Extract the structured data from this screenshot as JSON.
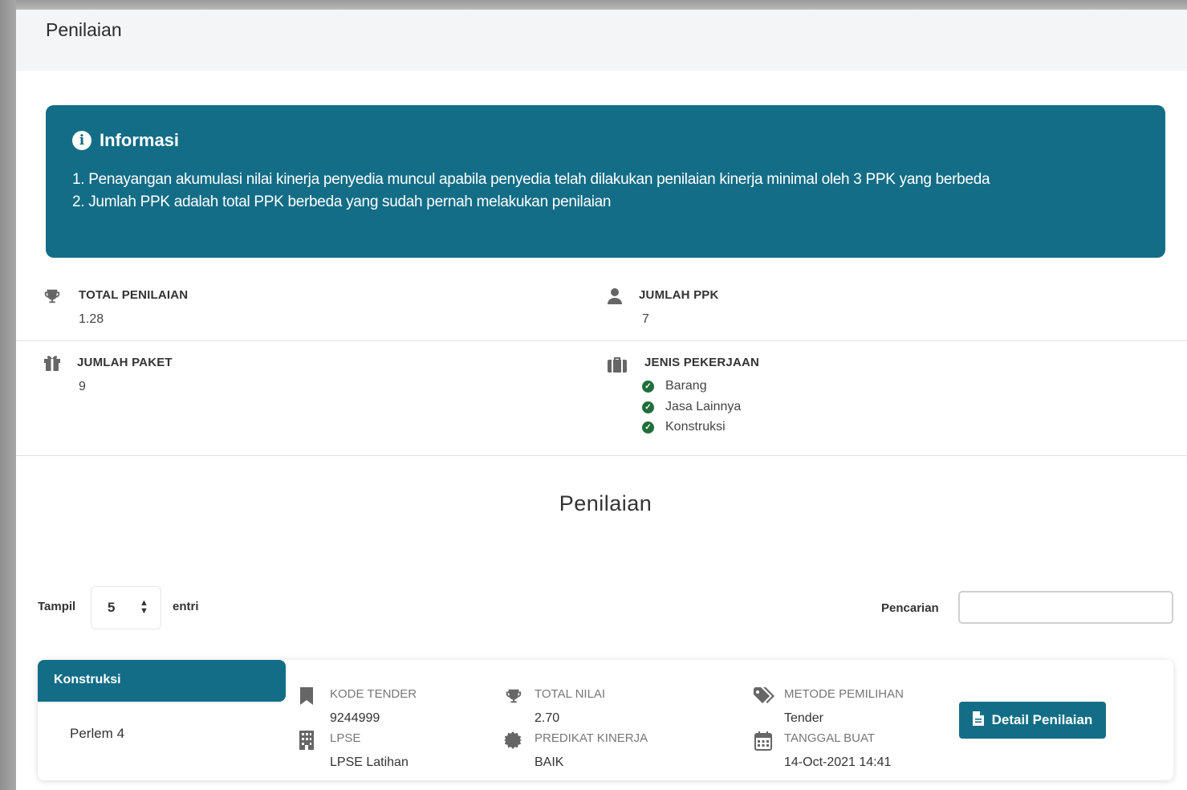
{
  "header": {
    "title": "Penilaian"
  },
  "info": {
    "title": "Informasi",
    "lines": [
      "1. Penayangan akumulasi nilai kinerja penyedia muncul apabila penyedia telah dilakukan penilaian kinerja minimal oleh 3 PPK yang berbeda",
      "2. Jumlah PPK adalah total PPK berbeda yang sudah pernah melakukan penilaian"
    ]
  },
  "stats": {
    "total_penilaian": {
      "label": "TOTAL PENILAIAN",
      "value": "1.28",
      "icon": "trophy-icon"
    },
    "jumlah_ppk": {
      "label": "JUMLAH PPK",
      "value": "7",
      "icon": "user-icon"
    },
    "jumlah_paket": {
      "label": "JUMLAH PAKET",
      "value": "9",
      "icon": "gift-icon"
    },
    "jenis_pekerjaan": {
      "label": "JENIS PEKERJAAN",
      "icon": "briefcase-icon",
      "items": [
        "Barang",
        "Jasa Lainnya",
        "Konstruksi"
      ]
    }
  },
  "section": {
    "title": "Penilaian"
  },
  "table_controls": {
    "show_label": "Tampil",
    "entries_value": "5",
    "entries_suffix": "entri",
    "search_label": "Pencarian",
    "search_value": ""
  },
  "records": [
    {
      "category": "Konstruksi",
      "name": "Perlem 4",
      "kode_tender_label": "KODE TENDER",
      "kode_tender": "9244999",
      "lpse_label": "LPSE",
      "lpse": "LPSE Latihan",
      "total_nilai_label": "TOTAL NILAI",
      "total_nilai": "2.70",
      "predikat_label": "PREDIKAT KINERJA",
      "predikat": "BAIK",
      "metode_label": "METODE PEMILIHAN",
      "metode": "Tender",
      "tanggal_label": "TANGGAL BUAT",
      "tanggal": "14-Oct-2021 14:41",
      "button_label": "Detail Penilaian"
    }
  ],
  "colors": {
    "primary": "#136d86",
    "check": "#1f6f3a"
  }
}
